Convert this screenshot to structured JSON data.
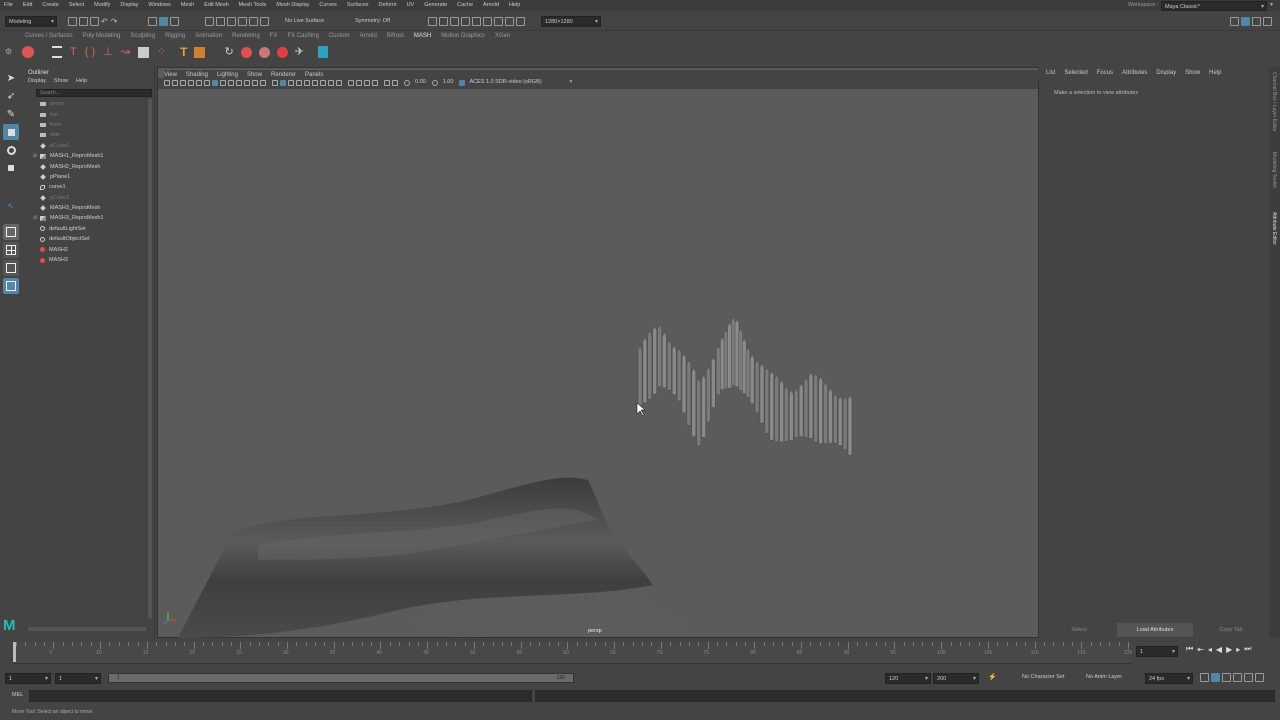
{
  "menubar": {
    "items": [
      "File",
      "Edit",
      "Create",
      "Select",
      "Modify",
      "Display",
      "Windows",
      "Mesh",
      "Edit Mesh",
      "Mesh Tools",
      "Mesh Display",
      "Curves",
      "Surfaces",
      "Deform",
      "UV",
      "Generate",
      "Cache",
      "Arnold",
      "Help"
    ],
    "workspace_label": "Workspace :",
    "workspace_value": "Maya Classic*"
  },
  "status_line": {
    "mode": "Modeling",
    "live_surface": "No Live Surface",
    "symmetry": "Symmetry: Off",
    "resolution": "1280×1280"
  },
  "shelf": {
    "tabs": [
      "Curves / Surfaces",
      "Poly Modeling",
      "Sculpting",
      "Rigging",
      "Animation",
      "Rendering",
      "FX",
      "FX Caching",
      "Custom",
      "Arnold",
      "Bifrost",
      "MASH",
      "Motion Graphics",
      "XGen"
    ],
    "active_tab": "MASH"
  },
  "outliner": {
    "title": "Outliner",
    "menu": [
      "Display",
      "Show",
      "Help"
    ],
    "search_placeholder": "Search...",
    "items": [
      {
        "label": "persp",
        "icon": "camera",
        "dim": true,
        "expand": false
      },
      {
        "label": "top",
        "icon": "camera",
        "dim": true,
        "expand": false
      },
      {
        "label": "front",
        "icon": "camera",
        "dim": true,
        "expand": false
      },
      {
        "label": "side",
        "icon": "camera",
        "dim": true,
        "expand": false
      },
      {
        "label": "pCube1",
        "icon": "mesh",
        "dim": true,
        "expand": false
      },
      {
        "label": "MASH1_ReproMesh1",
        "icon": "mash",
        "dim": false,
        "expand": true
      },
      {
        "label": "MASH2_ReproMesh",
        "icon": "mesh",
        "dim": false,
        "expand": false
      },
      {
        "label": "pPlane1",
        "icon": "mesh",
        "dim": false,
        "expand": false
      },
      {
        "label": "curve1",
        "icon": "curve",
        "dim": false,
        "expand": false
      },
      {
        "label": "pCube2",
        "icon": "mesh",
        "dim": true,
        "expand": false
      },
      {
        "label": "MASH3_ReproMesh",
        "icon": "mesh",
        "dim": false,
        "expand": false
      },
      {
        "label": "MASH3_ReproMesh1",
        "icon": "mash",
        "dim": false,
        "expand": true
      },
      {
        "label": "defaultLightSet",
        "icon": "set",
        "dim": false,
        "expand": false
      },
      {
        "label": "defaultObjectSet",
        "icon": "set",
        "dim": false,
        "expand": false
      },
      {
        "label": "MASH2",
        "icon": "mashnode",
        "dim": false,
        "expand": false
      },
      {
        "label": "MASH3",
        "icon": "mashnode",
        "dim": false,
        "expand": false
      }
    ]
  },
  "viewport": {
    "menu": [
      "View",
      "Shading",
      "Lighting",
      "Show",
      "Renderer",
      "Panels"
    ],
    "exposure": "0.00",
    "gamma": "1.00",
    "colorspace": "ACES 1.0 SDR-video (sRGB)",
    "camera_label": "persp"
  },
  "attribute_editor": {
    "menu": [
      "List",
      "Selected",
      "Focus",
      "Attributes",
      "Display",
      "Show",
      "Help"
    ],
    "hint": "Make a selection to view attributes",
    "buttons": [
      "Select",
      "Load Attributes",
      "Copy Tab"
    ],
    "side_tabs": [
      "Channel Box / Layer Editor",
      "Modeling Toolkit",
      "Attribute Editor"
    ]
  },
  "timeline": {
    "ticks": [
      "5",
      "10",
      "15",
      "20",
      "25",
      "30",
      "35",
      "40",
      "45",
      "50",
      "55",
      "60",
      "65",
      "70",
      "75",
      "80",
      "85",
      "90",
      "95",
      "100",
      "105",
      "110",
      "115",
      "120"
    ],
    "current_frame": "1"
  },
  "range_slider": {
    "start": "1",
    "inner_start": "1",
    "inner_end": "120",
    "end": "120",
    "max_end": "200",
    "character_set": "No Character Set",
    "anim_layer": "No Anim Layer",
    "fps": "24 fps"
  },
  "command_line": {
    "label": "MEL"
  },
  "help_line": {
    "text": "Move Tool: Select an object to move."
  }
}
